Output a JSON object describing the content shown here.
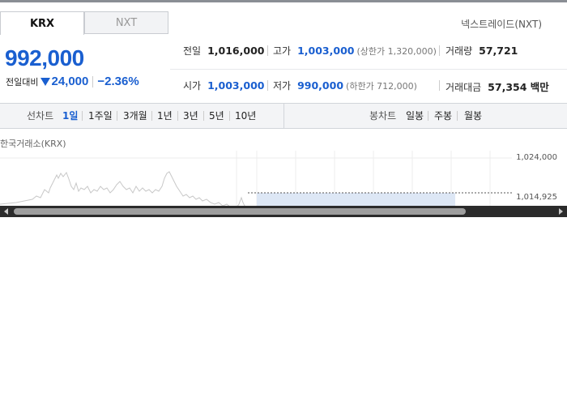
{
  "tabs": [
    {
      "label": "KRX",
      "active": true
    },
    {
      "label": "NXT",
      "active": false
    }
  ],
  "nxt_link": "넥스트레이드(NXT)",
  "price": {
    "current": "992,000",
    "change_label": "전일대비",
    "change_direction": "down",
    "change_icon": "down-triangle-icon",
    "change_value": "24,000",
    "change_percent": "−2.36%"
  },
  "stats": {
    "prev_close": {
      "label": "전일",
      "value": "1,016,000"
    },
    "high": {
      "label": "고가",
      "value": "1,003,000",
      "sub": "(상한가 1,320,000)"
    },
    "volume": {
      "label": "거래량",
      "value": "57,721"
    },
    "open": {
      "label": "시가",
      "value": "1,003,000"
    },
    "low": {
      "label": "저가",
      "value": "990,000",
      "sub": "(하한가 712,000)"
    },
    "amount": {
      "label": "거래대금",
      "value": "57,354 백만"
    }
  },
  "line_chart": {
    "label": "선차트",
    "periods": [
      "1일",
      "1주일",
      "3개월",
      "1년",
      "3년",
      "5년",
      "10년"
    ],
    "selected": "1일"
  },
  "candle_chart": {
    "label": "봉차트",
    "periods": [
      "일봉",
      "주봉",
      "월봉"
    ]
  },
  "chart_title": "한국거래소(KRX)",
  "y_labels": [
    "1,024,000",
    "1,014,925"
  ],
  "colors": {
    "blue": "#1a5fd0",
    "chart_line": "#c8c8c8",
    "chart_fill": "#dde7f5"
  },
  "scroll_icons": {
    "left": "scroll-left-arrow-icon",
    "right": "scroll-right-arrow-icon"
  }
}
